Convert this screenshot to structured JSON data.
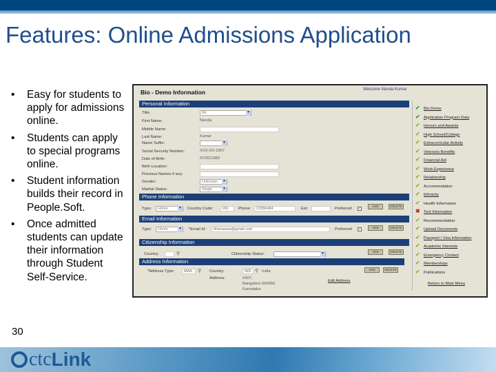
{
  "slide": {
    "title": "Features: Online Admissions Application",
    "slide_number": "30",
    "bullets": [
      "Easy for students to apply for admissions online.",
      "Students can apply to special programs online.",
      "Student information builds their record in People.Soft.",
      "Once admitted students can update their information through Student Self-Service."
    ],
    "bullet_glyph": "•",
    "logo": "ctcLink"
  },
  "app": {
    "header": "Bio - Demo Information",
    "welcome": "Welcome Nanda Kumar",
    "personal": {
      "title": "Personal Information",
      "fields": [
        {
          "label": "Title:",
          "value": "Mr."
        },
        {
          "label": "First Name:",
          "value": "Nanda"
        },
        {
          "label": "Middle Name:",
          "value": ""
        },
        {
          "label": "Last Name:",
          "value": "Kumar"
        },
        {
          "label": "Name Suffix:",
          "value": ""
        },
        {
          "label": "Social Security Number:",
          "value": "XXX-XX-2367"
        },
        {
          "label": "Date of Birth:",
          "value": "07/20/1983"
        },
        {
          "label": "Birth Location:",
          "value": ""
        },
        {
          "label": "Previous Names if any:",
          "value": ""
        },
        {
          "label": "Gender:",
          "value": "Unknown"
        },
        {
          "label": "Marital Status:",
          "value": "Single"
        }
      ]
    },
    "phone": {
      "title": "Phone Information",
      "type_label": "Type:",
      "type": "Home",
      "cc_label": "Country Code:",
      "cc": "091",
      "phone_label": "Phone:",
      "phone": "23356484",
      "ext_label": "Ext:",
      "ext": "",
      "preferred_label": "Preferred:"
    },
    "email": {
      "title": "Email Information",
      "type_label": "Type:",
      "type": "Home",
      "id_label": "*Email Id:",
      "id": "bhavasara@gmail.com",
      "preferred_label": "Preferred:"
    },
    "citizenship": {
      "title": "Citizenship Information",
      "country_label": "Country:",
      "country": "",
      "status_label": "Citizenship Status:",
      "status": ""
    },
    "address": {
      "title": "Address Information",
      "type_label": "*Address Type:",
      "type": "MAIL",
      "country_label": "Country:",
      "country": "IND",
      "country_name": "India",
      "address_label": "Address:",
      "lines": [
        "#307,",
        "Bangalore 560050",
        "Karnataka"
      ],
      "edit": "Edit Address"
    },
    "buttons": {
      "add": "ADD",
      "delete": "DELETE"
    },
    "sidebar": {
      "items": [
        {
          "label": "Bio-Demo",
          "status": "done"
        },
        {
          "label": "Application Program Data",
          "status": "done"
        },
        {
          "label": "Honors and Awards",
          "status": "ok"
        },
        {
          "label": "High School/College",
          "status": "ok"
        },
        {
          "label": "Extracurricular Activity",
          "status": "ok"
        },
        {
          "label": "Veterans Benefits",
          "status": "ok"
        },
        {
          "label": "Financial Aid",
          "status": "ok"
        },
        {
          "label": "Work Experience",
          "status": "ok"
        },
        {
          "label": "Relationship",
          "status": "ok"
        },
        {
          "label": "Accommodation",
          "status": "ok"
        },
        {
          "label": "Ethnicity",
          "status": "ok"
        },
        {
          "label": "Health Information",
          "status": "ok"
        },
        {
          "label": "Test Information",
          "status": "error"
        },
        {
          "label": "Recommendation",
          "status": "ok"
        },
        {
          "label": "Upload Documents",
          "status": "ok"
        },
        {
          "label": "Passport / Visa Information",
          "status": "ok"
        },
        {
          "label": "Academic Interests",
          "status": "ok"
        },
        {
          "label": "Emergency Contact",
          "status": "ok"
        },
        {
          "label": "Memberships",
          "status": "ok"
        },
        {
          "label": "Publications",
          "status": "ok"
        }
      ],
      "return": "Return to Main Menu"
    }
  },
  "colors": {
    "title": "#1f4e8c",
    "topbar": "#00457f",
    "section": "#1c3f78"
  }
}
